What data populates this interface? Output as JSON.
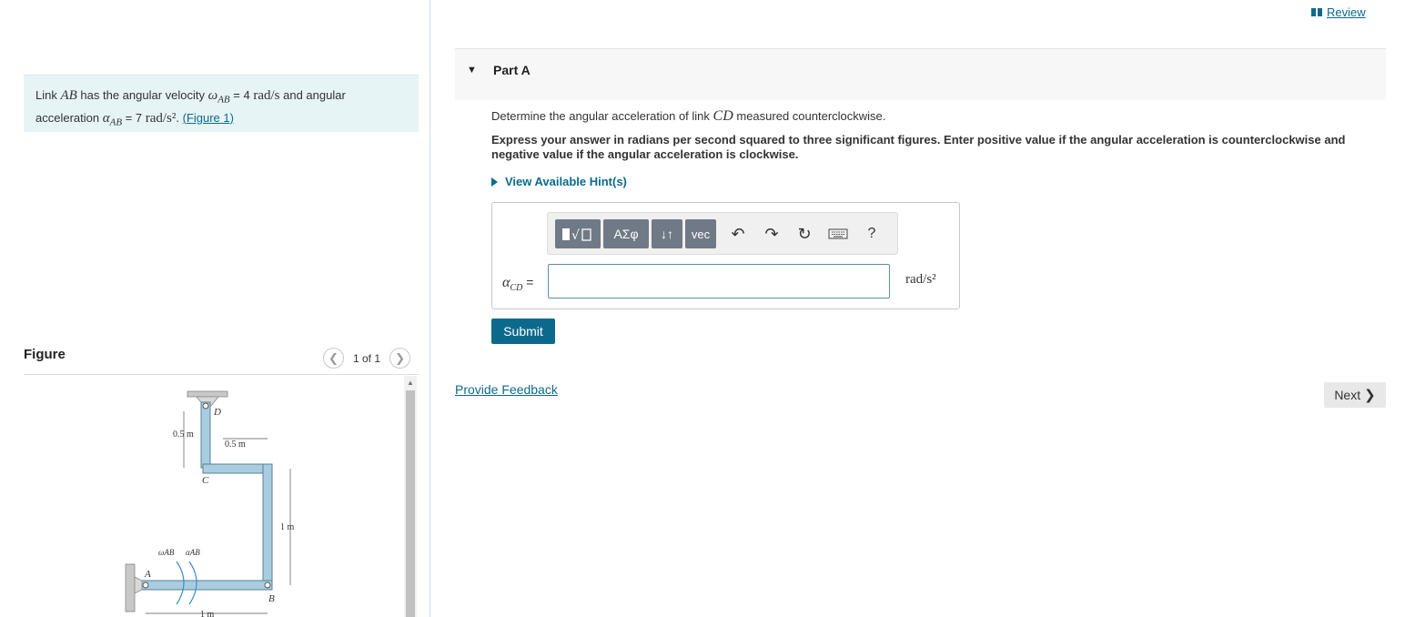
{
  "problem": {
    "text_1": "Link ",
    "ab": "AB",
    "text_2": " has the angular velocity ",
    "omega_sym": "ω",
    "omega_sub": "AB",
    "omega_val": " = 4 ",
    "omega_unit": "rad/s",
    "text_3": " and angular acceleration ",
    "alpha_sym": "α",
    "alpha_sub": "AB",
    "alpha_val": " = 7 ",
    "alpha_unit": "rad/s²",
    "text_4": ". ",
    "figure_link": "(Figure 1)"
  },
  "figure_panel": {
    "title": "Figure",
    "prev_icon": "chevron-left-icon",
    "next_icon": "chevron-right-icon",
    "count": "1 of 1"
  },
  "figure": {
    "labels": {
      "d": "D",
      "c": "C",
      "a": "A",
      "b": "B",
      "dim_cd": "0.5 m",
      "dim_top": "0.5 m",
      "dim_vert": "1 m",
      "dim_bottom": "1 m",
      "omega": "ωAB",
      "alpha": "αAB"
    },
    "link_color": "#a9cde0"
  },
  "header": {
    "review_label": "Review",
    "part_label": "Part A"
  },
  "question": {
    "text_1": "Determine the angular acceleration of link ",
    "cd": "CD",
    "text_2": " measured counterclockwise.",
    "instructions": "Express your answer in radians per second squared to three significant figures. Enter positive value if the angular acceleration is counterclockwise and negative value if the angular acceleration is clockwise.",
    "hints_label": "View Available Hint(s)"
  },
  "answer": {
    "toolbar": {
      "templates_icon": "templates-icon",
      "greek_label": "ΑΣφ",
      "updown_label": "↓↑",
      "vec_label": "vec",
      "help_label": "?"
    },
    "variable_sym": "α",
    "variable_sub": "CD",
    "equals": " =",
    "value": "",
    "units": "rad/s²",
    "submit_label": "Submit"
  },
  "footer": {
    "feedback_label": "Provide Feedback",
    "next_label": "Next"
  },
  "colors": {
    "accent": "#0b6a8c",
    "problem_bg": "#e6f4f6",
    "toolbar_btn": "#6f7a86"
  }
}
